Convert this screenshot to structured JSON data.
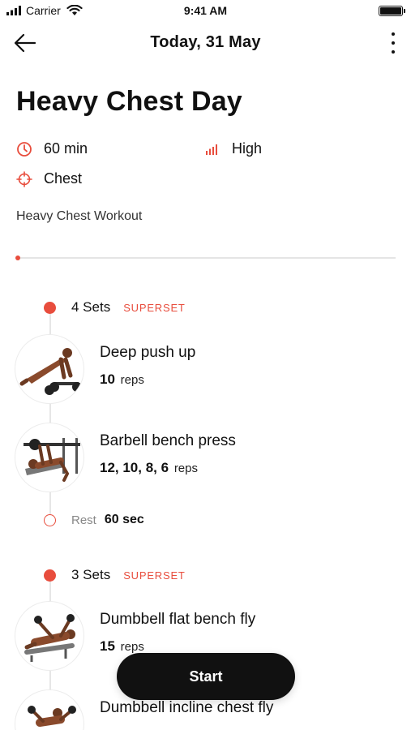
{
  "status_bar": {
    "carrier": "Carrier",
    "time": "9:41 AM",
    "icons": [
      "signal-icon",
      "wifi-icon",
      "battery-icon"
    ]
  },
  "nav": {
    "title": "Today, 31 May",
    "back_icon": "arrow-left-icon",
    "more_icon": "more-vertical-icon"
  },
  "workout": {
    "title": "Heavy Chest Day",
    "duration": "60 min",
    "intensity": "High",
    "muscle": "Chest",
    "description": "Heavy Chest Workout",
    "progress": 0
  },
  "groups": [
    {
      "sets": "4 Sets",
      "tag": "SUPERSET",
      "exercises": [
        {
          "name": "Deep push up",
          "reps": "10",
          "unit": "reps"
        },
        {
          "name": "Barbell bench press",
          "reps": "12, 10, 8, 6",
          "unit": "reps"
        }
      ],
      "rest": {
        "label": "Rest",
        "value": "60 sec"
      }
    },
    {
      "sets": "3 Sets",
      "tag": "SUPERSET",
      "exercises": [
        {
          "name": "Dumbbell flat bench fly",
          "reps": "15",
          "unit": "reps"
        },
        {
          "name": "Dumbbell incline chest fly",
          "reps": "",
          "unit": ""
        }
      ]
    }
  ],
  "start_label": "Start",
  "colors": {
    "accent": "#e84d3d",
    "text": "#111111",
    "muted": "#888888",
    "button": "#111111"
  }
}
